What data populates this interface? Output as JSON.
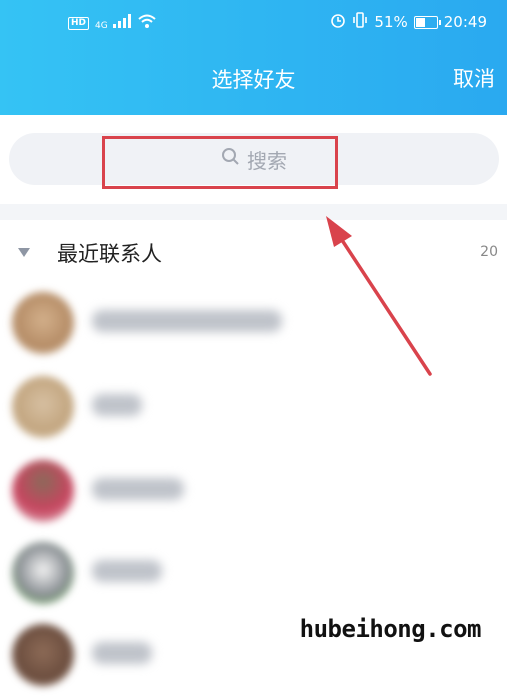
{
  "status_bar": {
    "hd": "HD",
    "network": "4G",
    "battery": "51%",
    "battery_level": 0.51,
    "time": "20:49",
    "icons": [
      "signal-icon",
      "wifi-icon",
      "alarm-icon",
      "vibrate-icon",
      "battery-icon"
    ]
  },
  "header": {
    "title": "选择好友",
    "cancel_label": "取消"
  },
  "search": {
    "placeholder": "搜索",
    "icon": "search-icon"
  },
  "section": {
    "label": "最近联系人",
    "count": "20"
  },
  "contacts_visible_count": 5,
  "colors": {
    "header_start": "#35c3f4",
    "header_end": "#2aa9f0",
    "highlight": "#d9434c",
    "search_bg": "#f0f2f6"
  },
  "watermark": "hubeihong.com"
}
